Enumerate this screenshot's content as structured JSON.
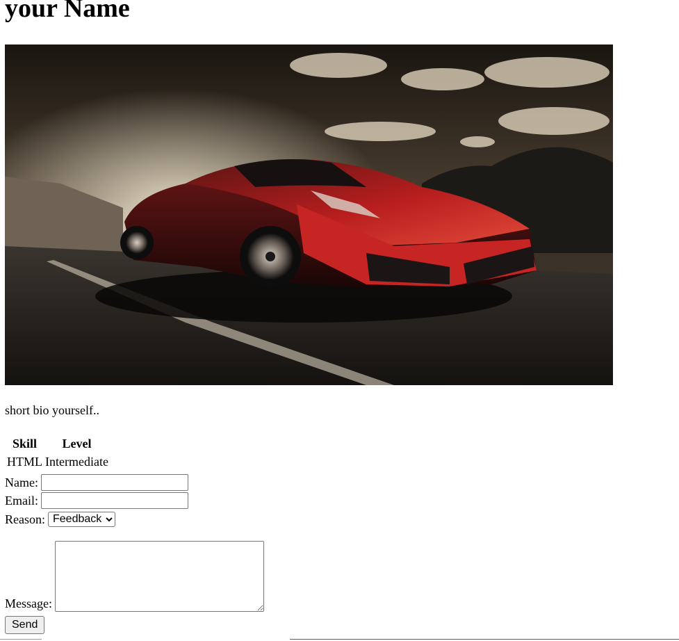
{
  "header": {
    "title": "your Name"
  },
  "hero_image": {
    "alt": "",
    "description_icon": "car-photo"
  },
  "bio": {
    "text": "short bio yourself.."
  },
  "skills_table": {
    "headers": [
      "Skill",
      "Level"
    ],
    "rows": [
      [
        "HTML",
        "Intermediate"
      ]
    ]
  },
  "form": {
    "name_label": "Name:",
    "name_value": "",
    "email_label": "Email:",
    "email_value": "",
    "reason_label": "Reason:",
    "reason_selected": "Feedback",
    "message_label": "Message:",
    "message_value": "",
    "send_label": "Send"
  }
}
